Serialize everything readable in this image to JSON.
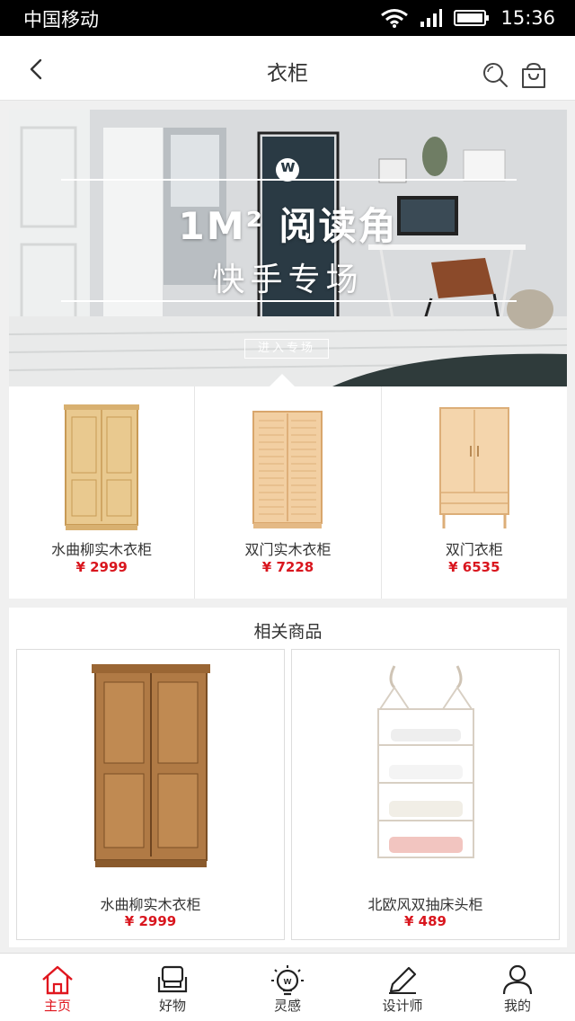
{
  "status": {
    "carrier": "中国移动",
    "time": "15:36"
  },
  "nav": {
    "title": "衣柜"
  },
  "banner": {
    "line1": "1M² 阅读角",
    "line2": "快手专场",
    "button": "进入专场",
    "logo_letter": "w"
  },
  "products": [
    {
      "name": "水曲柳实木衣柜",
      "price": "¥ 2999"
    },
    {
      "name": "双门实木衣柜",
      "price": "¥ 7228"
    },
    {
      "name": "双门衣柜",
      "price": "¥ 6535"
    }
  ],
  "related": {
    "title": "相关商品",
    "items": [
      {
        "name": "水曲柳实木衣柜",
        "price": "¥ 2999"
      },
      {
        "name": "北欧风双抽床头柜",
        "price": "¥ 489"
      }
    ]
  },
  "tabs": [
    {
      "label": "主页",
      "icon": "home-icon",
      "active": true
    },
    {
      "label": "好物",
      "icon": "sofa-icon",
      "active": false
    },
    {
      "label": "灵感",
      "icon": "lightbulb-icon",
      "active": false
    },
    {
      "label": "设计师",
      "icon": "pencil-icon",
      "active": false
    },
    {
      "label": "我的",
      "icon": "person-icon",
      "active": false
    }
  ],
  "colors": {
    "accent": "#e0161e",
    "price": "#d9161e"
  }
}
